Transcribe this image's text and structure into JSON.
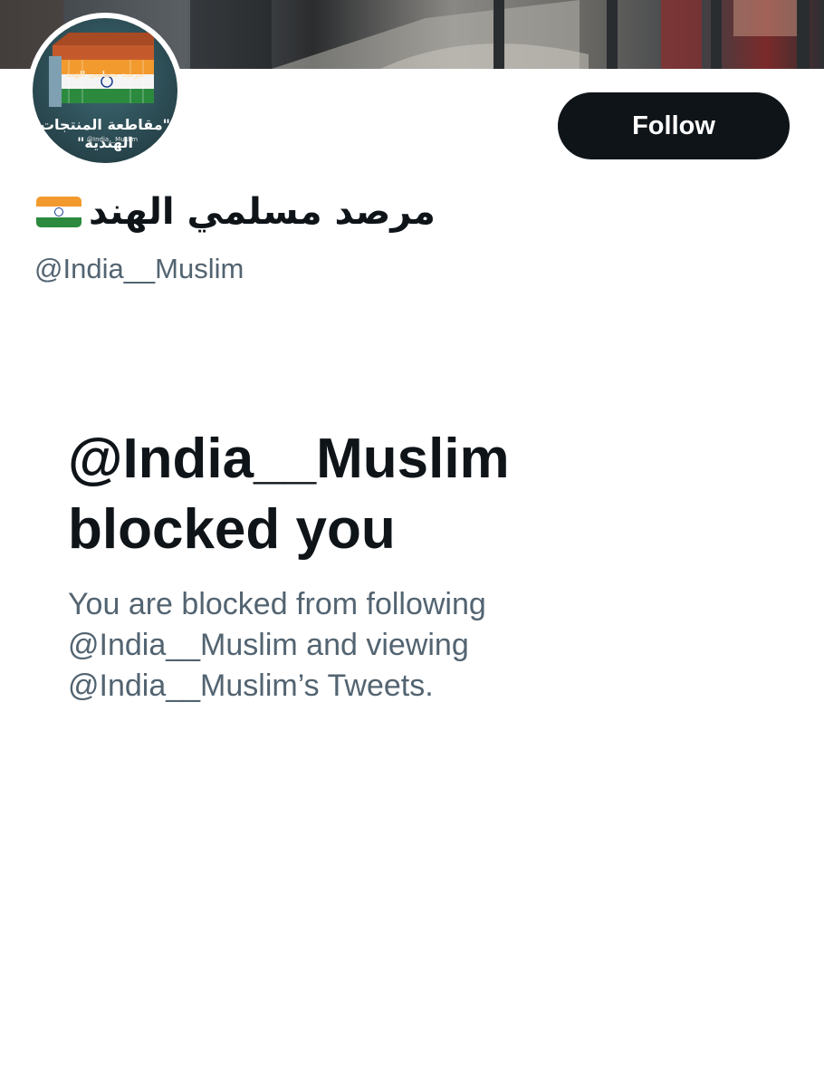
{
  "banner": {
    "description_colors": [
      "#3a3f45",
      "#8a8884",
      "#7b2a2a"
    ]
  },
  "avatar": {
    "top_text": "مرصد مسلمي الهند",
    "main_text_line1": "\"مقاطعة المنتجات",
    "main_text_line2": "الهندية\"",
    "handle_text": "@India__Muslim"
  },
  "profile": {
    "display_name": "مرصد مسلمي الهند",
    "flag_icon": "india-flag-icon",
    "handle": "@India__Muslim"
  },
  "actions": {
    "follow_label": "Follow"
  },
  "blocked": {
    "title_line1": "@India__Muslim",
    "title_line2": "blocked you",
    "desc_line1": "You are blocked from following",
    "desc_line2": "@India__Muslim and viewing",
    "desc_line3": "@India__Muslim’s Tweets."
  },
  "colors": {
    "primary_text": "#0f1419",
    "secondary_text": "#536471",
    "button_bg": "#0f1419",
    "button_text": "#ffffff"
  }
}
